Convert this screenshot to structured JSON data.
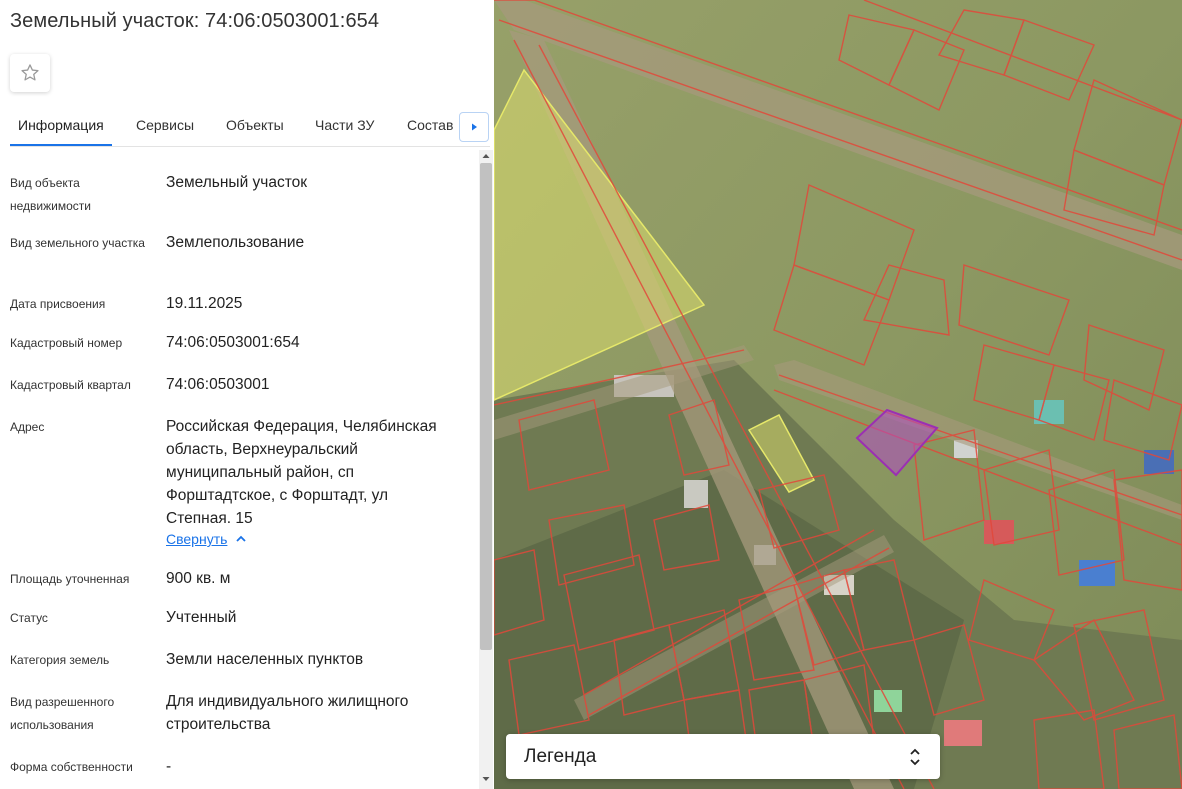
{
  "header": {
    "title": "Земельный участок: 74:06:0503001:654"
  },
  "tabs": [
    {
      "label": "Информация"
    },
    {
      "label": "Сервисы"
    },
    {
      "label": "Объекты"
    },
    {
      "label": "Части ЗУ"
    },
    {
      "label": "Состав"
    }
  ],
  "info": {
    "rows": [
      {
        "label": "Вид объекта недвижимости",
        "value": "Земельный участок"
      },
      {
        "label": "Вид земельного участка",
        "value": "Землепользование"
      },
      {
        "label": "Дата присвоения",
        "value": "19.11.2025"
      },
      {
        "label": "Кадастровый номер",
        "value": "74:06:0503001:654"
      },
      {
        "label": "Кадастровый квартал",
        "value": "74:06:0503001"
      },
      {
        "label": "Адрес",
        "value": "Российская Федерация, Челябинская область, Верхнеуральский муниципальный район, сп Форштадтское, с Форштадт, ул Степная. 15"
      },
      {
        "label": "Площадь уточненная",
        "value": "900 кв. м"
      },
      {
        "label": "Статус",
        "value": "Учтенный"
      },
      {
        "label": "Категория земель",
        "value": "Земли населенных пунктов"
      },
      {
        "label": "Вид разрешенного использования",
        "value": "Для индивидуального жилищного строительства"
      },
      {
        "label": "Форма собственности",
        "value": "-"
      }
    ],
    "collapse_label": "Свернуть"
  },
  "map": {
    "legend_label": "Легенда"
  },
  "colors": {
    "accent": "#1a73e8",
    "parcel_border": "#e2483a",
    "selected_parcel": "#9b2fb3",
    "highlight_parcel": "#e6e86a"
  },
  "icons": {
    "favorite": "star-outline-icon",
    "tabs_next": "caret-right-icon",
    "collapse": "chevron-up-icon",
    "legend_toggle": "unfold-icon"
  }
}
